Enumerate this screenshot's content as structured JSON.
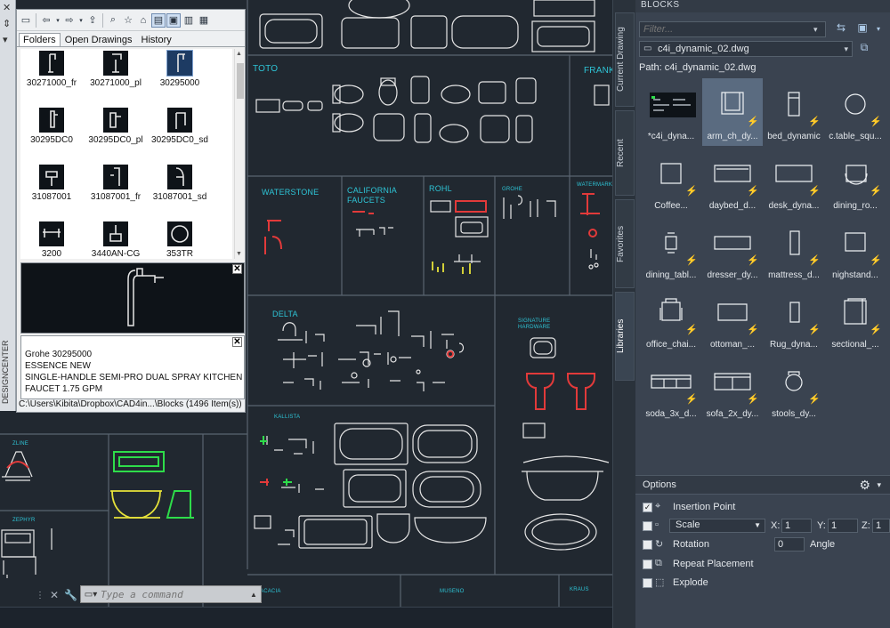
{
  "designcenter": {
    "title": "DESIGNCENTER",
    "tabs": [
      {
        "label": "Folders",
        "active": true
      },
      {
        "label": "Open Drawings",
        "active": false
      },
      {
        "label": "History",
        "active": false
      }
    ],
    "items": [
      {
        "name": "30271000_fr"
      },
      {
        "name": "30271000_pl"
      },
      {
        "name": "30295000",
        "selected": true
      },
      {
        "name": "30295DC0"
      },
      {
        "name": "30295DC0_pl"
      },
      {
        "name": "30295DC0_sd"
      },
      {
        "name": "31087001"
      },
      {
        "name": "31087001_fr"
      },
      {
        "name": "31087001_sd"
      },
      {
        "name": "3200"
      },
      {
        "name": "3440AN-CG"
      },
      {
        "name": "353TR"
      }
    ],
    "description": [
      "Grohe 30295000",
      "ESSENCE NEW",
      "SINGLE-HANDLE SEMI-PRO DUAL SPRAY KITCHEN",
      "FAUCET 1.75 GPM"
    ],
    "path_status": "C:\\Users\\Kibita\\Dropbox\\CAD4in...\\Blocks (1496 Item(s))"
  },
  "canvas": {
    "labels": [
      "TOTO",
      "FRANK",
      "WATERSTONE",
      "CALIFORNIA",
      "FAUCETS",
      "ROHL",
      "GROHE",
      "WATERMARK",
      "DELTA",
      "SIGNATURE",
      "HARDWARE",
      "KALLISTA",
      "ZLINE",
      "ZEPHYR",
      "ACACIA",
      "MUSENO",
      "KRAUS"
    ]
  },
  "command": {
    "placeholder": "Type a command"
  },
  "side_tabs": [
    {
      "label": "Current Drawing"
    },
    {
      "label": "Recent"
    },
    {
      "label": "Favorites"
    },
    {
      "label": "Libraries",
      "active": true
    }
  ],
  "blocks": {
    "title": "BLOCKS",
    "filter_placeholder": "Filter...",
    "file": "c4i_dynamic_02.dwg",
    "path": "Path: c4i_dynamic_02.dwg",
    "items": [
      {
        "name": "*c4i_dyna...",
        "icon": "drawing-thumbnail"
      },
      {
        "name": "arm_ch_dy...",
        "icon": "armchair",
        "selected": true
      },
      {
        "name": "bed_dynamic",
        "icon": "bed"
      },
      {
        "name": "c.table_squ...",
        "icon": "round-table"
      },
      {
        "name": "Coffee...",
        "icon": "coffee-table"
      },
      {
        "name": "daybed_d...",
        "icon": "daybed"
      },
      {
        "name": "desk_dyna...",
        "icon": "desk"
      },
      {
        "name": "dining_ro...",
        "icon": "dining-round"
      },
      {
        "name": "dining_tabl...",
        "icon": "dining-table"
      },
      {
        "name": "dresser_dy...",
        "icon": "dresser"
      },
      {
        "name": "mattress_d...",
        "icon": "mattress"
      },
      {
        "name": "nighstand...",
        "icon": "nightstand"
      },
      {
        "name": "office_chai...",
        "icon": "office-chair"
      },
      {
        "name": "ottoman_...",
        "icon": "ottoman"
      },
      {
        "name": "Rug_dyna...",
        "icon": "rug"
      },
      {
        "name": "sectional_...",
        "icon": "sectional"
      },
      {
        "name": "soda_3x_d...",
        "icon": "sofa-3"
      },
      {
        "name": "sofa_2x_dy...",
        "icon": "sofa-2"
      },
      {
        "name": "stools_dy...",
        "icon": "stool"
      }
    ]
  },
  "options": {
    "title": "Options",
    "insertion_point": "Insertion Point",
    "scale": "Scale",
    "x_label": "X:",
    "x_value": "1",
    "y_label": "Y:",
    "y_value": "1",
    "z_label": "Z:",
    "z_value": "1",
    "rotation": "Rotation",
    "angle_value": "0",
    "angle_label": "Angle",
    "repeat": "Repeat Placement",
    "explode": "Explode"
  },
  "colors": {
    "canvas_bg": "#212830",
    "cad_label": "#2ec4d6",
    "lightning": "#f3c224",
    "selected_block": "#5a6b80"
  }
}
